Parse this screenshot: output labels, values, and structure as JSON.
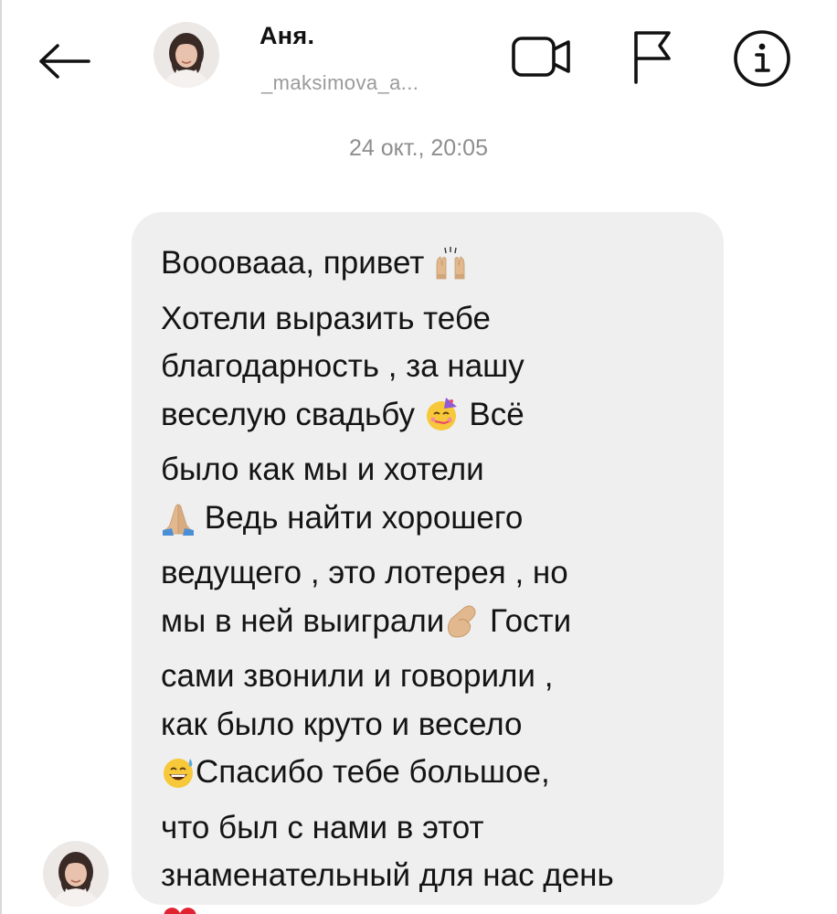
{
  "header": {
    "name": "Аня.",
    "handle": "_maksimova_a..."
  },
  "icons": {
    "back": "arrow-left-icon",
    "video": "video-call-icon",
    "flag": "report-flag-icon",
    "info": "info-icon",
    "avatar": "profile-photo"
  },
  "conversation": {
    "timestamp": "24 окт., 20:05",
    "message": {
      "lines": [
        {
          "text": "Вооовааа, привет",
          "emoji_after": "raising-hands"
        },
        {
          "text": "Хотели выразить тебе"
        },
        {
          "text": "благодарность , за нашу"
        },
        {
          "text": "веселую свадьбу",
          "emoji_after": "partying-face",
          "text_after": " Всё"
        },
        {
          "text": "было как мы и хотели"
        },
        {
          "emoji_before": "folded-hands",
          "text": " Ведь найти хорошего"
        },
        {
          "text": "ведущего , это лотерея , но"
        },
        {
          "text": "мы в ней выиграли",
          "emoji_after": "pinching-hand",
          "text_after": " Гости"
        },
        {
          "text": "сами звонили и говорили ,"
        },
        {
          "text": "как было круто и весело"
        },
        {
          "emoji_before": "grinning-sweat",
          "text": "Спасибо тебе большое,"
        },
        {
          "text": "что был с нами в этот"
        },
        {
          "text": "знаменательный для нас день"
        },
        {
          "emoji_before": "red-heart",
          "text": ""
        }
      ]
    }
  },
  "colors": {
    "bubble": "#efefef",
    "secondary_text": "#8e8e8e",
    "heart": "#e0242f"
  }
}
